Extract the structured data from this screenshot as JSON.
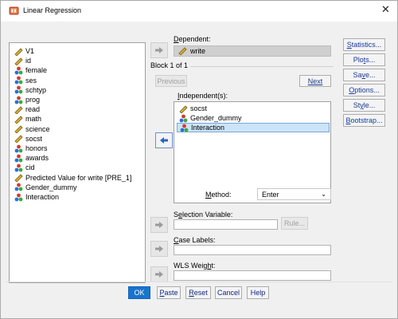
{
  "window": {
    "title": "Linear Regression",
    "close_glyph": "✕"
  },
  "variables": [
    {
      "label": "V1",
      "type": "scale"
    },
    {
      "label": "id",
      "type": "scale"
    },
    {
      "label": "female",
      "type": "nominal"
    },
    {
      "label": "ses",
      "type": "nominal"
    },
    {
      "label": "schtyp",
      "type": "nominal"
    },
    {
      "label": "prog",
      "type": "nominal"
    },
    {
      "label": "read",
      "type": "scale"
    },
    {
      "label": "math",
      "type": "scale"
    },
    {
      "label": "science",
      "type": "scale"
    },
    {
      "label": "socst",
      "type": "scale"
    },
    {
      "label": "honors",
      "type": "nominal"
    },
    {
      "label": "awards",
      "type": "nominal"
    },
    {
      "label": "cid",
      "type": "nominal"
    },
    {
      "label": "Predicted Value for write [PRE_1]",
      "type": "scale"
    },
    {
      "label": "Gender_dummy",
      "type": "nominal"
    },
    {
      "label": "Interaction",
      "type": "nominal"
    }
  ],
  "dependent": {
    "label_mn": "D",
    "label_rest": "ependent:",
    "value": "write",
    "value_type": "scale"
  },
  "block": {
    "text": "Block 1 of 1",
    "previous": "Previous",
    "next": "Next"
  },
  "independent": {
    "label_mn": "I",
    "label_rest": "ndependent(s):",
    "items": [
      {
        "label": "socst",
        "type": "scale"
      },
      {
        "label": "Gender_dummy",
        "type": "nominal"
      },
      {
        "label": "Interaction",
        "type": "nominal",
        "selected": true
      }
    ]
  },
  "method": {
    "label_mn": "M",
    "label_rest": "ethod:",
    "value": "Enter"
  },
  "selection": {
    "label_pre": "S",
    "label_mn": "e",
    "label_rest": "lection Variable:",
    "value": "",
    "rule": "Rule..."
  },
  "case_labels": {
    "label_mn": "C",
    "label_rest": "ase Labels:",
    "value": ""
  },
  "wls": {
    "label_pre": "WLS Weig",
    "label_mn": "h",
    "label_rest": "t:",
    "value": ""
  },
  "side_buttons": [
    {
      "mn": "S",
      "rest": "tatistics..."
    },
    {
      "pre": "Plo",
      "mn": "t",
      "rest": "s..."
    },
    {
      "pre": "Sa",
      "mn": "v",
      "rest": "e..."
    },
    {
      "mn": "O",
      "rest": "ptions..."
    },
    {
      "pre": "St",
      "mn": "y",
      "rest": "le..."
    },
    {
      "mn": "B",
      "rest": "ootstrap..."
    }
  ],
  "footer": {
    "ok": "OK",
    "paste_mn": "P",
    "paste_rest": "aste",
    "reset_mn": "R",
    "reset_rest": "eset",
    "cancel": "Cancel",
    "help": "Help"
  },
  "colors": {
    "accent": "#1874cd",
    "scale_icon": "#c8a21a",
    "nominal_red": "#d23b2f",
    "nominal_blue": "#2f6fd2",
    "nominal_green": "#3aa845"
  }
}
